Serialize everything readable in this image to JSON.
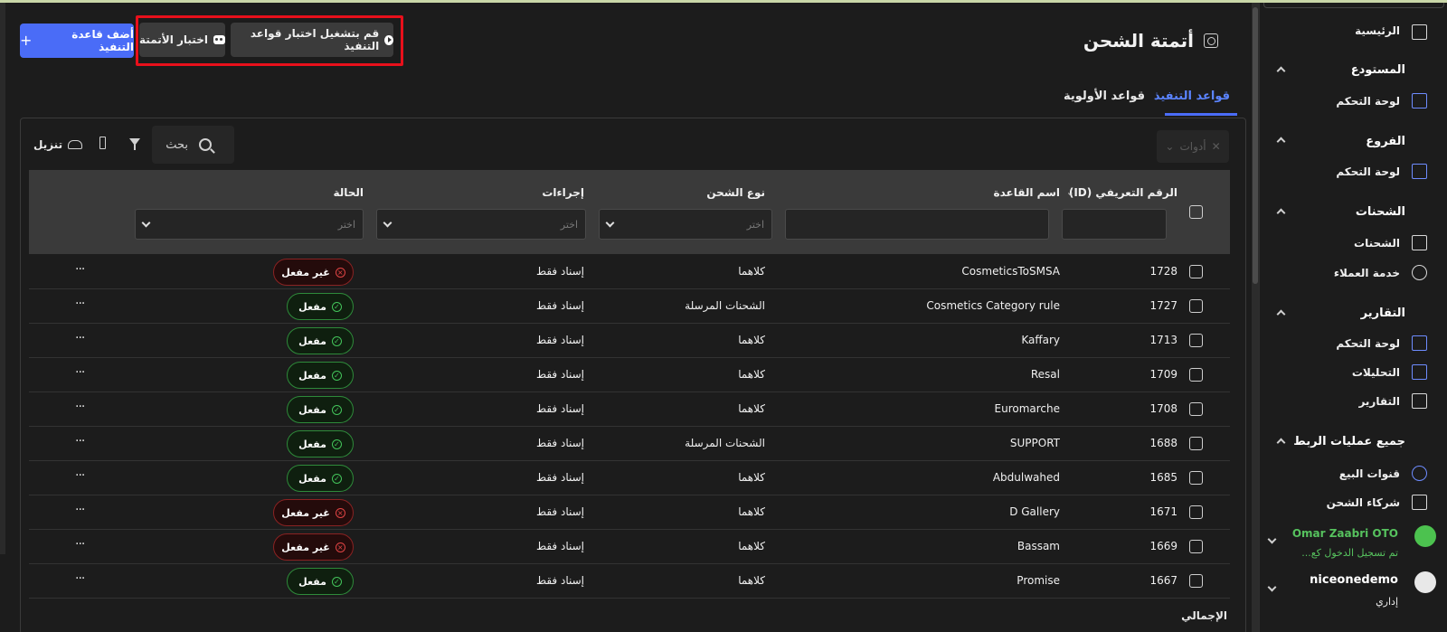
{
  "page": {
    "title": "أتمتة الشحن"
  },
  "actions": {
    "add_rule": "أضف قاعدة التنفيذ",
    "test_automation": "اختبار الأتمتة",
    "run_rules_test": "قم بتشغيل اختبار قواعد التنفيذ"
  },
  "tabs": [
    {
      "label": "قواعد التنفيذ",
      "active": true
    },
    {
      "label": "قواعد الأولوية",
      "active": false
    }
  ],
  "toolbar": {
    "tools_label": "أدوات",
    "search_placeholder": "بحث",
    "download_label": "تنزيل"
  },
  "table": {
    "headers": {
      "id": "الرقم التعريفي (ID)",
      "rule_name": "اسم القاعدة",
      "shipping_type": "نوع الشحن",
      "actions": "إجراءات",
      "status": "الحالة"
    },
    "filter_placeholder": "اختر",
    "rows": [
      {
        "id": "1728",
        "name": "CosmeticsToSMSA",
        "type": "كلاهما",
        "action": "إسناد فقط",
        "status": "غير مفعل",
        "enabled": false
      },
      {
        "id": "1727",
        "name": "Cosmetics Category rule",
        "type": "الشحنات المرسلة",
        "action": "إسناد فقط",
        "status": "مفعل",
        "enabled": true
      },
      {
        "id": "1713",
        "name": "Kaffary",
        "type": "كلاهما",
        "action": "إسناد فقط",
        "status": "مفعل",
        "enabled": true
      },
      {
        "id": "1709",
        "name": "Resal",
        "type": "كلاهما",
        "action": "إسناد فقط",
        "status": "مفعل",
        "enabled": true
      },
      {
        "id": "1708",
        "name": "Euromarche",
        "type": "كلاهما",
        "action": "إسناد فقط",
        "status": "مفعل",
        "enabled": true
      },
      {
        "id": "1688",
        "name": "SUPPORT",
        "type": "الشحنات المرسلة",
        "action": "إسناد فقط",
        "status": "مفعل",
        "enabled": true
      },
      {
        "id": "1685",
        "name": "Abdulwahed",
        "type": "كلاهما",
        "action": "إسناد فقط",
        "status": "مفعل",
        "enabled": true
      },
      {
        "id": "1671",
        "name": "D Gallery",
        "type": "كلاهما",
        "action": "إسناد فقط",
        "status": "غير مفعل",
        "enabled": false
      },
      {
        "id": "1669",
        "name": "Bassam",
        "type": "كلاهما",
        "action": "إسناد فقط",
        "status": "غير مفعل",
        "enabled": false
      },
      {
        "id": "1667",
        "name": "Promise",
        "type": "كلاهما",
        "action": "إسناد فقط",
        "status": "مفعل",
        "enabled": true
      }
    ],
    "row_menu": "···",
    "total_label": "الإجمالي"
  },
  "sidebar": {
    "home": "الرئيسية",
    "warehouse": {
      "title": "المستودع",
      "dashboard": "لوحة التحكم"
    },
    "branches": {
      "title": "الفروع",
      "dashboard": "لوحة التحكم"
    },
    "shipments": {
      "title": "الشحنات",
      "shipments": "الشحنات",
      "customer_service": "خدمة العملاء"
    },
    "reports": {
      "title": "التقارير",
      "dashboard": "لوحة التحكم",
      "analytics": "التحليلات",
      "reports": "التقارير"
    },
    "integrations": {
      "title": "جميع عمليات الربط",
      "sales_channels": "قنوات البيع",
      "shipping_partners": "شركاء الشحن"
    },
    "support_user": {
      "name": "Omar Zaabri OTO",
      "status": "تم تسجيل الدخول كع..."
    },
    "account": {
      "name": "niceonedemo",
      "role": "إداري"
    }
  },
  "colors": {
    "accent": "#4a6cf7",
    "highlight_box": "#e8101b",
    "enabled": "#43c45a",
    "disabled": "#e04444"
  }
}
